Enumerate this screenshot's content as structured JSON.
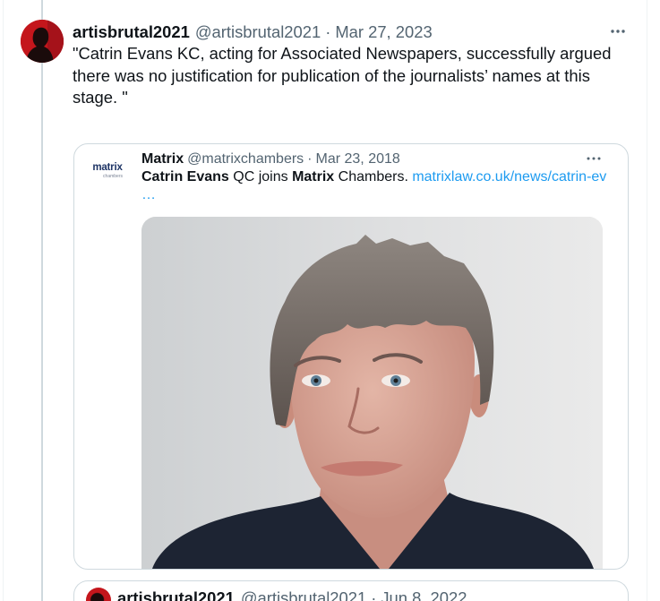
{
  "colors": {
    "text": "#0f1419",
    "secondary": "#536471",
    "link": "#1d9bf0",
    "card_border": "#cfd9de",
    "column_border": "#eff3f4",
    "thread_line": "#cfd9de",
    "avatar_red": "#c4161c",
    "logo": "#1f3566"
  },
  "icons": {
    "tweet_more": "more-horizontal-icon",
    "quoted_more": "more-horizontal-icon"
  },
  "tweet": {
    "display_name": "artisbrutal2021",
    "handle": "@artisbrutal2021",
    "separator": "·",
    "date": "Mar 27, 2023",
    "text": "\"Catrin Evans KC, acting for Associated Newspapers, successfully argued there was no justification for publication of the journalists’ names at this stage. \""
  },
  "quoted_tweet": {
    "logo": {
      "wordmark": "matrix",
      "subtitle": "chambers"
    },
    "display_name": "Matrix",
    "handle": "@matrixchambers",
    "separator": "·",
    "date": "Mar 23, 2018",
    "text": {
      "bold_name": "Catrin Evans",
      "middle": " QC joins ",
      "bold_org": "Matrix",
      "end": " Chambers. ",
      "link": "matrixlaw.co.uk/news/catrin-ev",
      "link_ellipsis": "…"
    }
  },
  "next_quoted_tweet": {
    "display_name": "artisbrutal2021",
    "handle": "@artisbrutal2021",
    "separator": "·",
    "date": "Jun 8, 2022"
  }
}
